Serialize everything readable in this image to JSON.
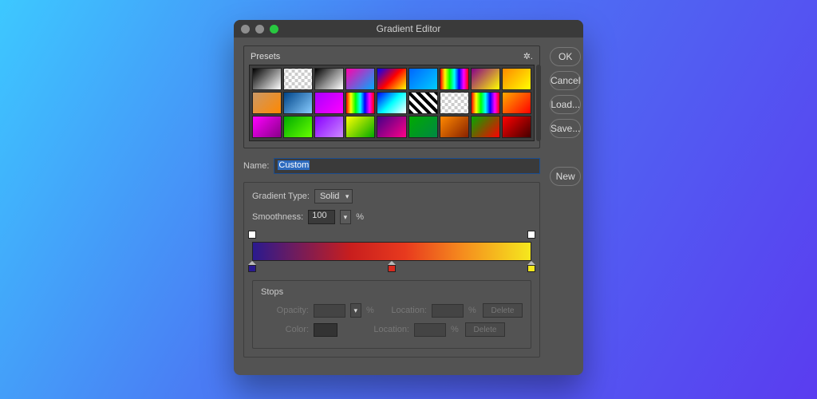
{
  "window": {
    "title": "Gradient Editor"
  },
  "presets": {
    "label": "Presets"
  },
  "buttons": {
    "ok": "OK",
    "cancel": "Cancel",
    "load": "Load...",
    "save": "Save...",
    "new": "New"
  },
  "name": {
    "label": "Name:",
    "value": "Custom"
  },
  "gradientType": {
    "label": "Gradient Type:",
    "value": "Solid"
  },
  "smoothness": {
    "label": "Smoothness:",
    "value": "100",
    "unit": "%"
  },
  "stops": {
    "title": "Stops",
    "opacity": {
      "label": "Opacity:",
      "value": "",
      "unit": "%"
    },
    "color": {
      "label": "Color:"
    },
    "location": {
      "label": "Location:",
      "value": "",
      "unit": "%"
    },
    "delete": "Delete"
  },
  "gradient": {
    "opacityStops": [
      0,
      100
    ],
    "colorStops": [
      {
        "pos": 0,
        "color": "#2a1a8f"
      },
      {
        "pos": 50,
        "color": "#d82a1e"
      },
      {
        "pos": 100,
        "color": "#f5e81e"
      }
    ]
  },
  "presetSwatches": [
    "linear-gradient(135deg,#000,#fff)",
    "repeating-conic-gradient(#ccc 0 25%,#fff 0 50%) 50%/8px 8px",
    "linear-gradient(135deg,#000,#888,#fff)",
    "linear-gradient(135deg,#f0a,#0af)",
    "linear-gradient(135deg,#00f,#f00,#ff0)",
    "linear-gradient(135deg,#06f,#0cf)",
    "linear-gradient(90deg,#f00,#ff0,#0f0,#0ff,#00f,#f0f,#f00)",
    "linear-gradient(135deg,#808,#ff0)",
    "linear-gradient(135deg,#f80,#ff0)",
    "linear-gradient(135deg,#c96,#f80)",
    "linear-gradient(135deg,#048,#8cf)",
    "linear-gradient(135deg,#a0f,#f0f)",
    "linear-gradient(90deg,#f00,#ff0,#0f0,#0ff,#00f,#f0f,#f00)",
    "linear-gradient(135deg,#00f,#0ff,#fff)",
    "repeating-linear-gradient(45deg,#000 0 4px,#fff 4px 8px)",
    "repeating-conic-gradient(#ccc 0 25%,#fff 0 50%) 50%/8px 8px",
    "linear-gradient(90deg,#f00,#ff0,#0f0,#0ff,#00f,#f0f,#f00)",
    "linear-gradient(135deg,#fa0,#f00)",
    "linear-gradient(135deg,#f0f,#808)",
    "linear-gradient(135deg,#0a0,#6f0)",
    "linear-gradient(135deg,#80f,#c8f)",
    "linear-gradient(135deg,#ff0,#0a0)",
    "linear-gradient(135deg,#408,#f08)",
    "linear-gradient(135deg,#0a0,#084)",
    "linear-gradient(135deg,#f80,#820)",
    "linear-gradient(135deg,#0a0,#f00)",
    "linear-gradient(135deg,#f00,#400)"
  ]
}
